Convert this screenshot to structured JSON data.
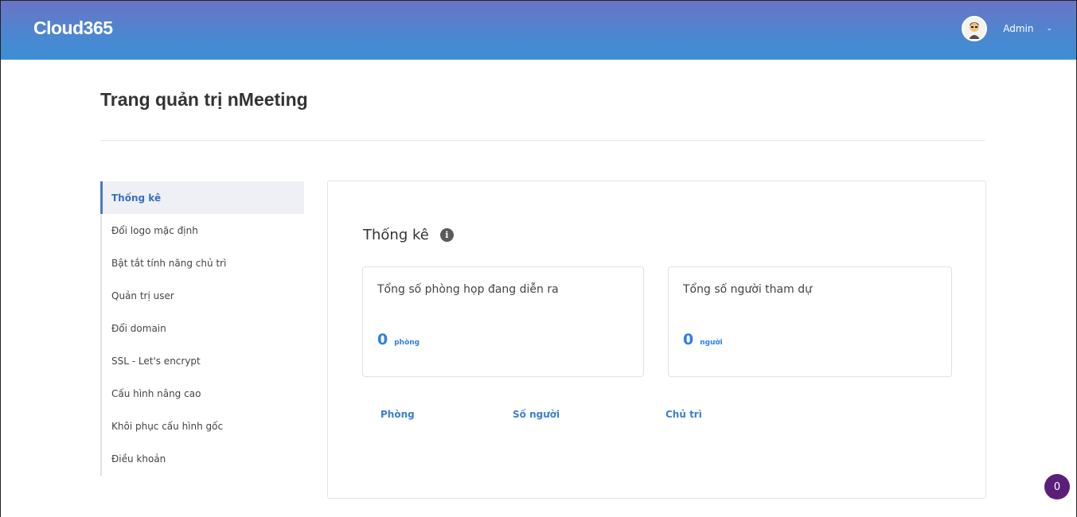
{
  "header": {
    "brand": "Cloud365",
    "user_name": "Admin",
    "avatar_icon": "user-avatar-icon",
    "dropdown_icon": "chevron-down-icon"
  },
  "page": {
    "title": "Trang quản trị nMeeting"
  },
  "sidebar": {
    "items": [
      {
        "label": "Thống kê",
        "active": true
      },
      {
        "label": "Đổi logo mặc định"
      },
      {
        "label": "Bật tắt tính năng chủ trì"
      },
      {
        "label": "Quản trị user"
      },
      {
        "label": "Đổi domain"
      },
      {
        "label": "SSL - Let's encrypt"
      },
      {
        "label": "Cấu hình nâng cao"
      },
      {
        "label": "Khôi phục cấu hình gốc"
      },
      {
        "label": "Điều khoản"
      }
    ]
  },
  "stats": {
    "title": "Thống kê",
    "info_icon": "info-icon",
    "cards": [
      {
        "label": "Tổng số phòng họp đang diễn ra",
        "value": "0",
        "unit": "phòng"
      },
      {
        "label": "Tổng số người tham dự",
        "value": "0",
        "unit": "người"
      }
    ],
    "table_headers": [
      "Phòng",
      "Số người",
      "Chủ trì"
    ]
  },
  "notification_badge": {
    "count": "0"
  },
  "colors": {
    "accent": "#3a6fbf",
    "value_blue": "#2e7fe0",
    "badge": "#5b1f7a"
  }
}
